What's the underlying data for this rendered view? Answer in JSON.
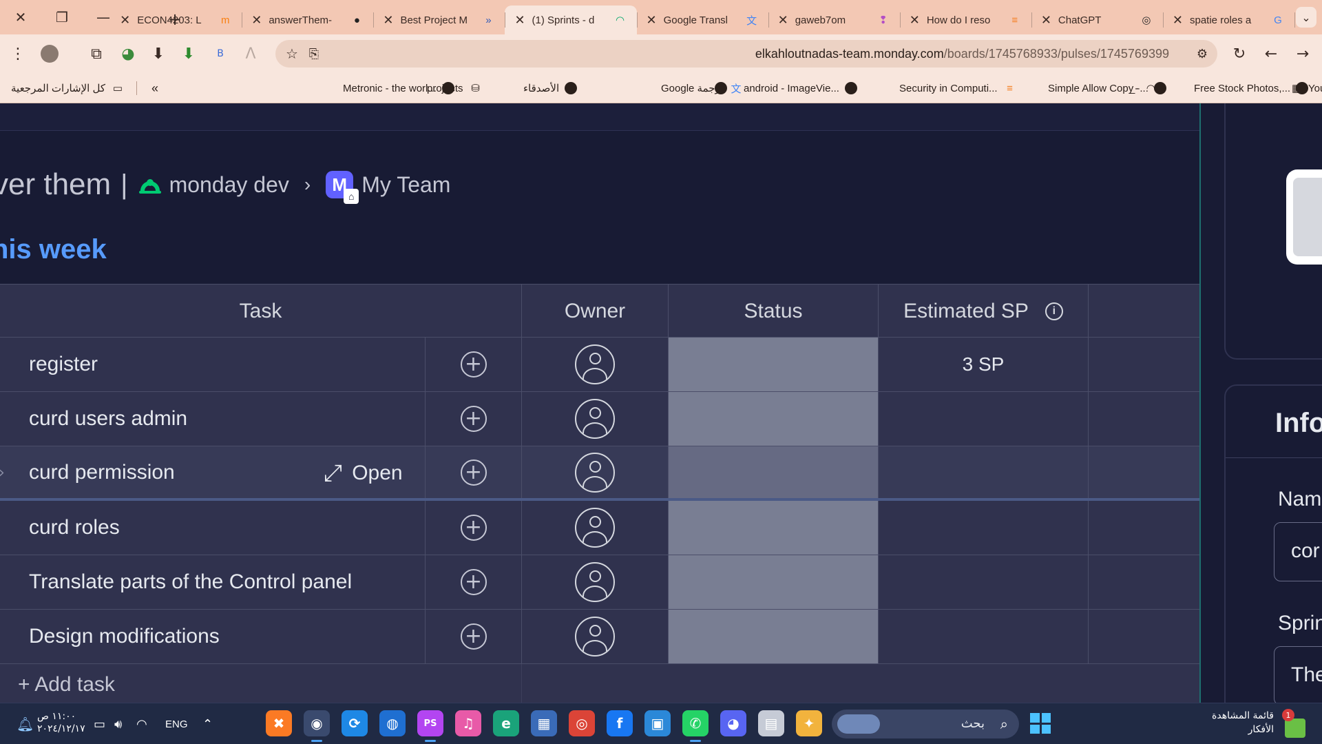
{
  "browser": {
    "tabs": [
      {
        "title": "spatie roles a",
        "icon": "google-icon",
        "icon_color": "#4285f4",
        "icon_glyph": "G"
      },
      {
        "title": "ChatGPT",
        "icon": "chatgpt-icon",
        "icon_color": "#2a2a2a",
        "icon_glyph": "◎"
      },
      {
        "title": "How do I reso",
        "icon": "stackoverflow-icon",
        "icon_color": "#f48024",
        "icon_glyph": "≡"
      },
      {
        "title": "gaweb7om",
        "icon": "bookmark-icon",
        "icon_color": "#b34ec5",
        "icon_glyph": "❢"
      },
      {
        "title": "Google Transl",
        "icon": "translate-icon",
        "icon_color": "#4285f4",
        "icon_glyph": "文"
      },
      {
        "title": "(1) Sprints - d",
        "icon": "monday-icon",
        "icon_color": "#00a86b",
        "icon_glyph": "◠",
        "active": true
      },
      {
        "title": "Best Project M",
        "icon": "project-icon",
        "icon_color": "#2f5ab8",
        "icon_glyph": "»"
      },
      {
        "title": "answerThem-",
        "icon": "github-icon",
        "icon_color": "#222222",
        "icon_glyph": "●"
      },
      {
        "title": "ECON4203: L",
        "icon": "moodle-icon",
        "icon_color": "#f98012",
        "icon_glyph": "m"
      }
    ],
    "new_tab": "+",
    "url_host": "elkahloutnadas-team.monday.com",
    "url_path": "/boards/1745768933/pulses/1745769399",
    "bookmarks": [
      {
        "label": "كل الإشارات المرجعية",
        "icon": "folder-icon"
      },
      {
        "label": "Metronic - the worl...",
        "icon": "globe-icon"
      },
      {
        "label": "projects",
        "icon": "drive-icon"
      },
      {
        "label": "الأصدقاء",
        "icon": "globe-icon"
      },
      {
        "label": "Google ترجمة",
        "icon": "translate-icon"
      },
      {
        "label": "",
        "icon": "globe-icon"
      },
      {
        "label": "android - ImageVie...",
        "icon": "globe-icon"
      },
      {
        "label": "Security in Computi...",
        "icon": "stackoverflow-icon"
      },
      {
        "label": "Simple Allow Copy -...",
        "icon": "globe-icon"
      },
      {
        "label": "_-",
        "icon": "rainbow-icon"
      },
      {
        "label": "Free Stock Photos,...",
        "icon": "globe-icon"
      },
      {
        "label": "YouTube",
        "icon": "youtube-icon"
      }
    ],
    "more_bookmarks": "«"
  },
  "board": {
    "name": "ver them",
    "workspace": "monday dev",
    "team_initial": "M",
    "team": "My Team",
    "group_title": "his week",
    "accent_color": "#579bfc",
    "columns": {
      "task": "Task",
      "owner": "Owner",
      "status": "Status",
      "estimated_sp": "Estimated SP"
    },
    "rows": [
      {
        "task": "register",
        "sp": "3 SP"
      },
      {
        "task": "curd users admin",
        "sp": ""
      },
      {
        "task": "curd permission",
        "sp": "",
        "open": "Open"
      },
      {
        "task": "curd roles",
        "sp": ""
      },
      {
        "task": "Translate parts of the Control panel",
        "sp": ""
      },
      {
        "task": "Design modifications",
        "sp": ""
      }
    ],
    "add_task": "+ Add task"
  },
  "side_panel": {
    "info": "Info",
    "name_label": "Nam",
    "name_value": "cor",
    "sprint_label": "Sprin",
    "sprint_value": "The"
  },
  "taskbar": {
    "time": "١١:٠٠ ص",
    "date": "٢٠٢٤/١٢/١٧",
    "lang": "ENG",
    "search_placeholder": "بحث",
    "watchlist": "قائمة المشاهدة",
    "ideas": "الأفكار",
    "notif_count": "1",
    "apps": [
      {
        "name": "xampp-icon",
        "color": "#fb7a24",
        "glyph": "✖"
      },
      {
        "name": "chrome-profile-icon",
        "color": "#3a4a6e",
        "glyph": "◉",
        "running": true
      },
      {
        "name": "sync-icon",
        "color": "#1e88e5",
        "glyph": "⟳"
      },
      {
        "name": "chat-icon",
        "color": "#1f6fd1",
        "glyph": "◍"
      },
      {
        "name": "phpstorm-icon",
        "color": "#b345f1",
        "glyph": "PS",
        "running": true
      },
      {
        "name": "itunes-icon",
        "color": "#e85aa8",
        "glyph": "♫"
      },
      {
        "name": "edge-icon",
        "color": "#1aa37a",
        "glyph": "e"
      },
      {
        "name": "calculator-icon",
        "color": "#3a6bb8",
        "glyph": "▦"
      },
      {
        "name": "chrome-icon",
        "color": "#db4437",
        "glyph": "◎"
      },
      {
        "name": "facebook-icon",
        "color": "#1877f2",
        "glyph": "f"
      },
      {
        "name": "store-icon",
        "color": "#2b88d8",
        "glyph": "▣"
      },
      {
        "name": "whatsapp-icon",
        "color": "#25d366",
        "glyph": "✆",
        "running": true
      },
      {
        "name": "discord-icon",
        "color": "#5865f2",
        "glyph": "◕"
      },
      {
        "name": "files-icon",
        "color": "#c6cbd6",
        "glyph": "▤"
      },
      {
        "name": "copilot-icon",
        "color": "#f2b33d",
        "glyph": "✦"
      }
    ]
  }
}
